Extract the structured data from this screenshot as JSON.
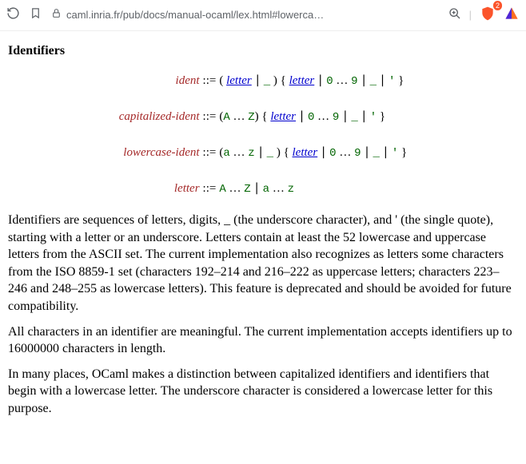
{
  "browser": {
    "url": "caml.inria.fr/pub/docs/manual-ocaml/lex.html#lowerca…",
    "badge": "2"
  },
  "title": "Identifiers",
  "gram": {
    "ident": {
      "lhs": "ident",
      "eq": "::="
    },
    "cap": {
      "lhs": "capitalized-ident",
      "eq": "::="
    },
    "low": {
      "lhs": "lowercase-ident",
      "eq": "::="
    },
    "letter": {
      "lhs": "letter",
      "eq": "::="
    }
  },
  "nt": {
    "letter": "letter"
  },
  "tok": {
    "us": "_",
    "zero": "0",
    "nine": "9",
    "sq": "'",
    "A": "A",
    "Z": "Z",
    "a": "a",
    "z": "z"
  },
  "meta": {
    "lp": "(",
    "rp": ")",
    "lb": "{",
    "rb": "}",
    "bar": "|",
    "dots": "…"
  },
  "paras": {
    "p1": "Identifiers are sequences of letters, digits, _ (the underscore character), and ' (the single quote), starting with a letter or an underscore. Letters contain at least the 52 lowercase and uppercase letters from the ASCII set. The current implementation also recognizes as letters some characters from the ISO 8859-1 set (characters 192–214 and 216–222 as uppercase letters; characters 223–246 and 248–255 as lowercase letters). This feature is deprecated and should be avoided for future compatibility.",
    "p2": "All characters in an identifier are meaningful. The current implementation accepts identifiers up to 16000000 characters in length.",
    "p3": "In many places, OCaml makes a distinction between capitalized identifiers and identifiers that begin with a lowercase letter. The underscore character is considered a lowercase letter for this purpose."
  }
}
